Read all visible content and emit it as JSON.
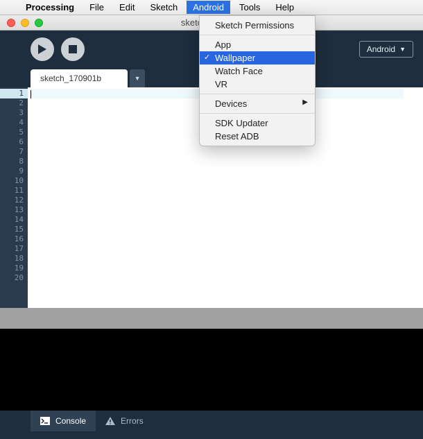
{
  "menubar": {
    "apple": "",
    "app": "Processing",
    "items": [
      "File",
      "Edit",
      "Sketch",
      "Android",
      "Tools",
      "Help"
    ],
    "active_index": 3
  },
  "titlebar": {
    "title": "sketch_170901"
  },
  "toolbar": {
    "mode_label": "Android"
  },
  "tab": {
    "name": "sketch_170901b"
  },
  "editor": {
    "line_count": 20,
    "current_line": 1
  },
  "bottom_tabs": {
    "console": "Console",
    "errors": "Errors"
  },
  "dropdown": {
    "groups": [
      [
        "Sketch Permissions"
      ],
      [
        "App",
        "Wallpaper",
        "Watch Face",
        "VR"
      ],
      [
        "Devices"
      ],
      [
        "SDK Updater",
        "Reset ADB"
      ]
    ],
    "selected": "Wallpaper",
    "submenu": "Devices"
  }
}
